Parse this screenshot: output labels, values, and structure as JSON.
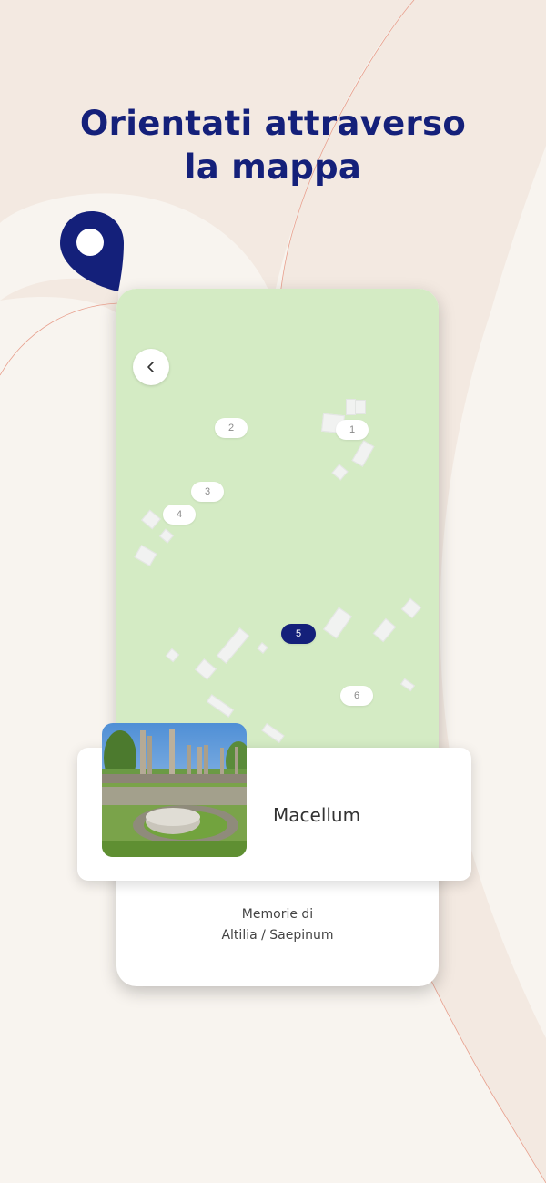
{
  "headline": {
    "line1": "Orientati attraverso",
    "line2": "la mappa"
  },
  "colors": {
    "navy": "#14207a",
    "map_green": "#d4ebc4",
    "background": "#f8f4ef",
    "band": "#f3e9e1",
    "curve_line": "#e8a08e"
  },
  "icons": {
    "location_pin": "location-pin-icon",
    "back": "chevron-left-icon"
  },
  "map": {
    "markers": [
      {
        "label": "1",
        "active": false
      },
      {
        "label": "2",
        "active": false
      },
      {
        "label": "3",
        "active": false
      },
      {
        "label": "4",
        "active": false
      },
      {
        "label": "5",
        "active": true
      },
      {
        "label": "6",
        "active": false
      }
    ]
  },
  "poi_card": {
    "title": "Macellum"
  },
  "footer": {
    "line1": "Memorie di",
    "line2": "Altilia / Saepinum"
  }
}
